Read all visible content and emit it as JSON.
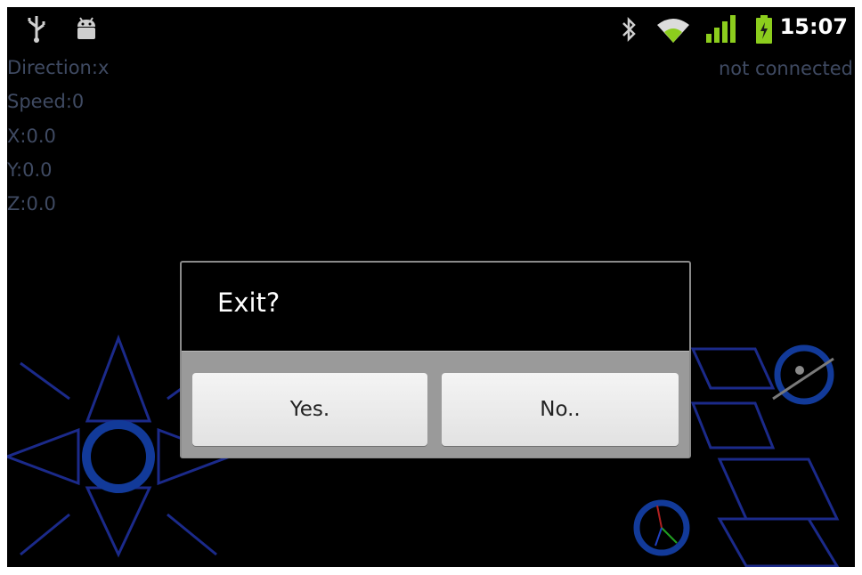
{
  "status_bar": {
    "time": "15:07",
    "icons": [
      "usb-icon",
      "android-debug-icon",
      "bluetooth-icon",
      "wifi-icon",
      "signal-icon",
      "battery-icon"
    ]
  },
  "telemetry": {
    "direction": "Direction:x",
    "speed": "Speed:0",
    "x": "X:0.0",
    "y": "Y:0.0",
    "z": "Z:0.0"
  },
  "connection_status": "not connected",
  "dialog": {
    "title": "Exit?",
    "yes_label": "Yes.",
    "no_label": "No.."
  },
  "colors": {
    "background": "#000000",
    "label_text": "#3f4a62",
    "control_outline": "#1b2a8a",
    "ring": "#123a99",
    "status_green": "#8ccd1d"
  }
}
